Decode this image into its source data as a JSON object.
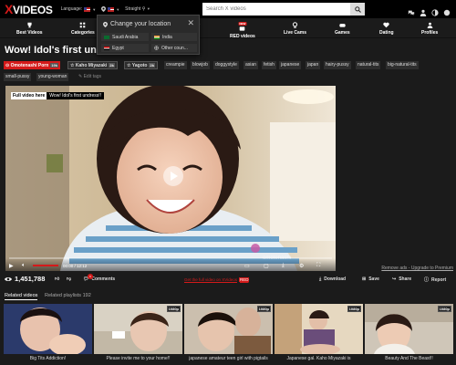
{
  "brand": {
    "x": "X",
    "rest": "VIDEOS"
  },
  "header": {
    "language_label": "Language:",
    "straight_label": "Straight",
    "search_placeholder": "Search X videos"
  },
  "nav": [
    {
      "label": "Best Videos",
      "icon": "trophy-icon"
    },
    {
      "label": "Categories",
      "icon": "grid-icon"
    },
    {
      "label": "s",
      "icon": "star-icon"
    },
    {
      "label": "RED videos",
      "icon": "red-icon",
      "badge": "NEW"
    },
    {
      "label": "Live Cams",
      "icon": "cam-icon"
    },
    {
      "label": "Games",
      "icon": "gamepad-icon"
    },
    {
      "label": "Dating",
      "icon": "heart-icon"
    },
    {
      "label": "Profiles",
      "icon": "profile-icon"
    }
  ],
  "location_popup": {
    "title": "Change your location",
    "options": [
      "Saudi Arabia",
      "India",
      "Egypt",
      "Other coun..."
    ]
  },
  "video": {
    "title": "Wow! Idol's first undre",
    "overlay_badge": "Full video here",
    "overlay_text": "Wow! Idol's first undress!!",
    "time": "00:00 / 12:12",
    "progress": 0.0
  },
  "tags": {
    "channel": {
      "label": "Omotenashi Porn",
      "count": "19k"
    },
    "models": [
      {
        "label": "Kaho Miyazaki",
        "count": "2k"
      },
      {
        "label": "Yagoto",
        "count": "2k"
      }
    ],
    "list": [
      "creampie",
      "blowjob",
      "doggystyle",
      "asian",
      "fetish",
      "japanese",
      "japan",
      "hairy-pussy",
      "natural-tits",
      "big-natural-tits",
      "small-pussy",
      "young-woman"
    ],
    "edit": "Edit tags"
  },
  "remove_ads": "Remove ads - Upgrade to Premium",
  "stats": {
    "views": "1,451,788",
    "comments_label": "Comments",
    "comments_count": "6",
    "full_video": "Get the full video on XVideos",
    "full_video_badge": "RED",
    "download": "Download",
    "save": "Save",
    "share": "Share",
    "report": "Report"
  },
  "tabs": {
    "related": "Related videos",
    "playlists": "Related playlists",
    "playlists_count": "192"
  },
  "thumbs": [
    {
      "caption": "Big Tits Addiction!",
      "quality": "",
      "duration": ""
    },
    {
      "caption": "Please invite me to your home!!",
      "quality": "1080p",
      "duration": ""
    },
    {
      "caption": "japanese amateur teen girl with pigtails",
      "quality": "1080p",
      "duration": ""
    },
    {
      "caption": "Japanese gal. Kaho Miyazaki is",
      "quality": "1080p",
      "duration": ""
    },
    {
      "caption": "Beauty And The Beast!!",
      "quality": "1080p",
      "duration": ""
    }
  ],
  "colors": {
    "accent": "#d41a1a",
    "bg": "#1b1b1b",
    "topbar": "#000000"
  }
}
